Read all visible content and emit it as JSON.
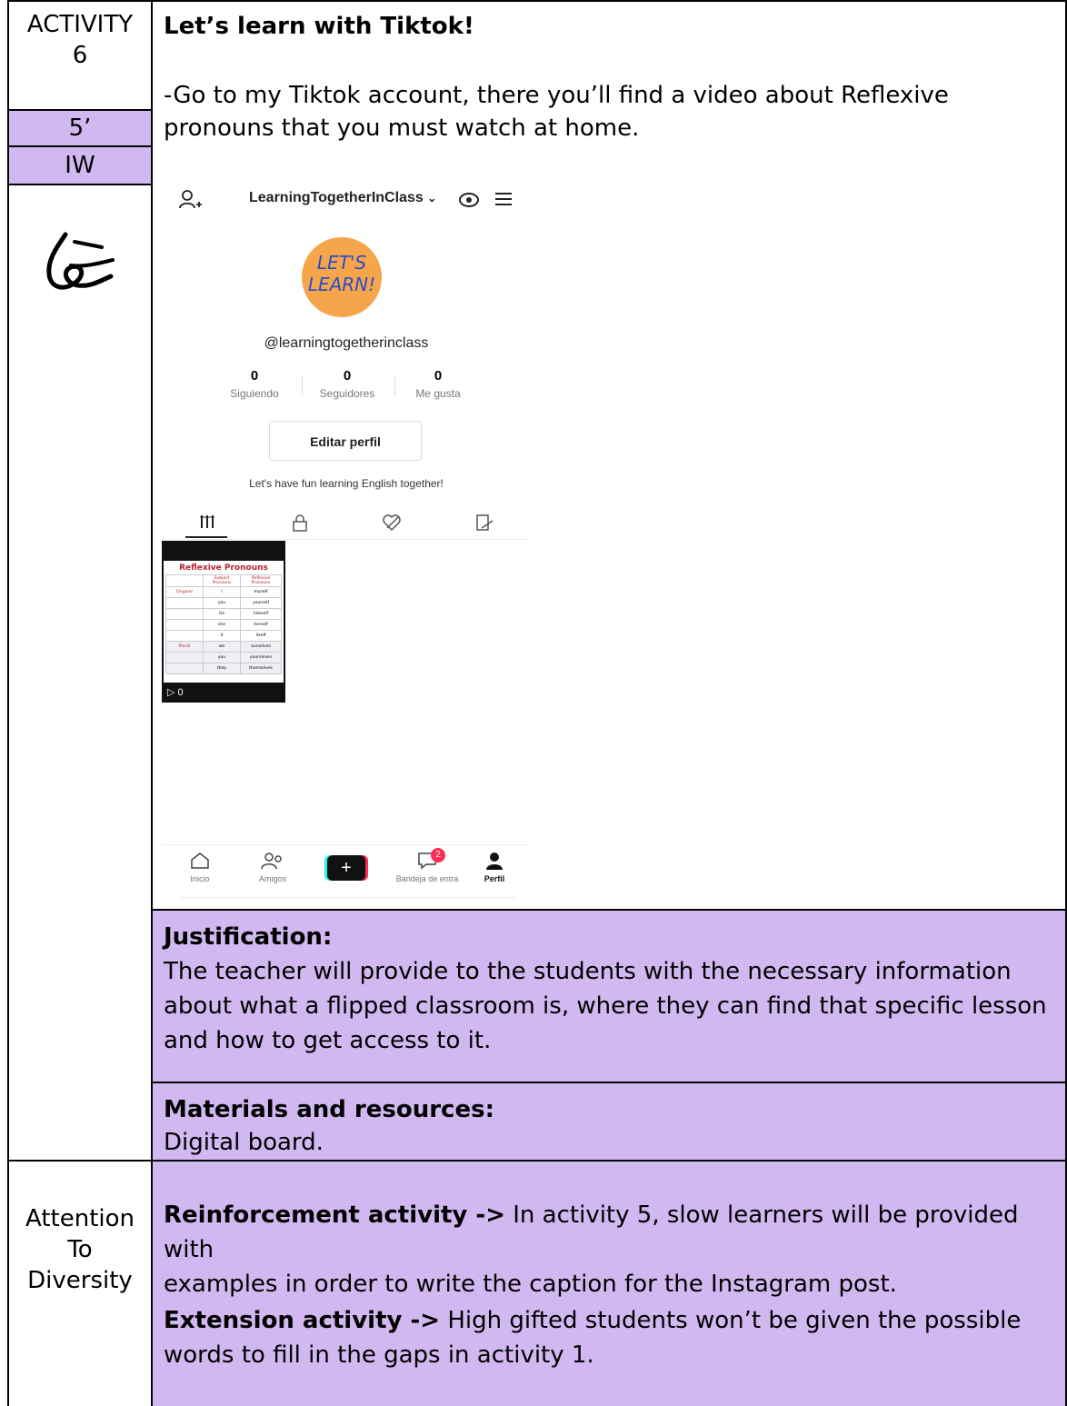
{
  "left_col": {
    "activity_label": "ACTIVITY",
    "activity_number": "6",
    "time": "5’",
    "grouping": "IW",
    "attention_lines": [
      "Attention",
      "To",
      "Diversity"
    ]
  },
  "activity": {
    "title": "Let’s learn with Tiktok!",
    "instruction_line1": "-Go to my Tiktok account, there you’ll find a video about Reflexive",
    "instruction_line2": "pronouns that you must watch at home."
  },
  "tiktok": {
    "username_header": "LearningTogetherInClass",
    "handle": "@learningtogetherinclass",
    "logo_line1": "LET'S",
    "logo_line2": "LEARN!",
    "stats": [
      {
        "value": "0",
        "label": "Siguiendo"
      },
      {
        "value": "0",
        "label": "Seguidores"
      },
      {
        "value": "0",
        "label": "Me gusta"
      }
    ],
    "edit_button": "Editar perfil",
    "bio": "Let's have fun learning English together!",
    "video": {
      "title": "Reflexive Pronouns",
      "col1": "Subject Pronouns",
      "col2": "Reflexive Pronouns",
      "rows": [
        {
          "group": "Singular",
          "subject": "I",
          "reflexive": "myself"
        },
        {
          "group": "",
          "subject": "you",
          "reflexive": "yourself"
        },
        {
          "group": "",
          "subject": "he",
          "reflexive": "himself"
        },
        {
          "group": "",
          "subject": "she",
          "reflexive": "herself"
        },
        {
          "group": "",
          "subject": "it",
          "reflexive": "itself"
        },
        {
          "group": "Plural",
          "subject": "we",
          "reflexive": "ourselves"
        },
        {
          "group": "",
          "subject": "you",
          "reflexive": "yourselves"
        },
        {
          "group": "",
          "subject": "they",
          "reflexive": "themselves"
        }
      ],
      "views": "0"
    },
    "nav": [
      {
        "label": "Inicio"
      },
      {
        "label": "Amigos"
      },
      {
        "label": "+"
      },
      {
        "label": "Bandeja de entra",
        "badge": "2"
      },
      {
        "label": "Perfil"
      }
    ]
  },
  "justification": {
    "heading": "Justification:",
    "lines": [
      "The teacher will provide to the students with the necessary information",
      "about what a flipped classroom is, where they can find that specific lesson",
      "and how to get access to it."
    ]
  },
  "materials": {
    "heading": "Materials and resources:",
    "text": "Digital board."
  },
  "diversity": {
    "reinforcement_label": "Reinforcement activity ->",
    "reinforcement_text1": " In activity 5, slow learners will be provided with",
    "reinforcement_text2": "examples in order to write the caption for the Instagram post.",
    "extension_label": "Extension activity ->",
    "extension_text1": " High gifted students won’t be given the possible",
    "extension_text2": "words to fill in the gaps in activity 1."
  }
}
